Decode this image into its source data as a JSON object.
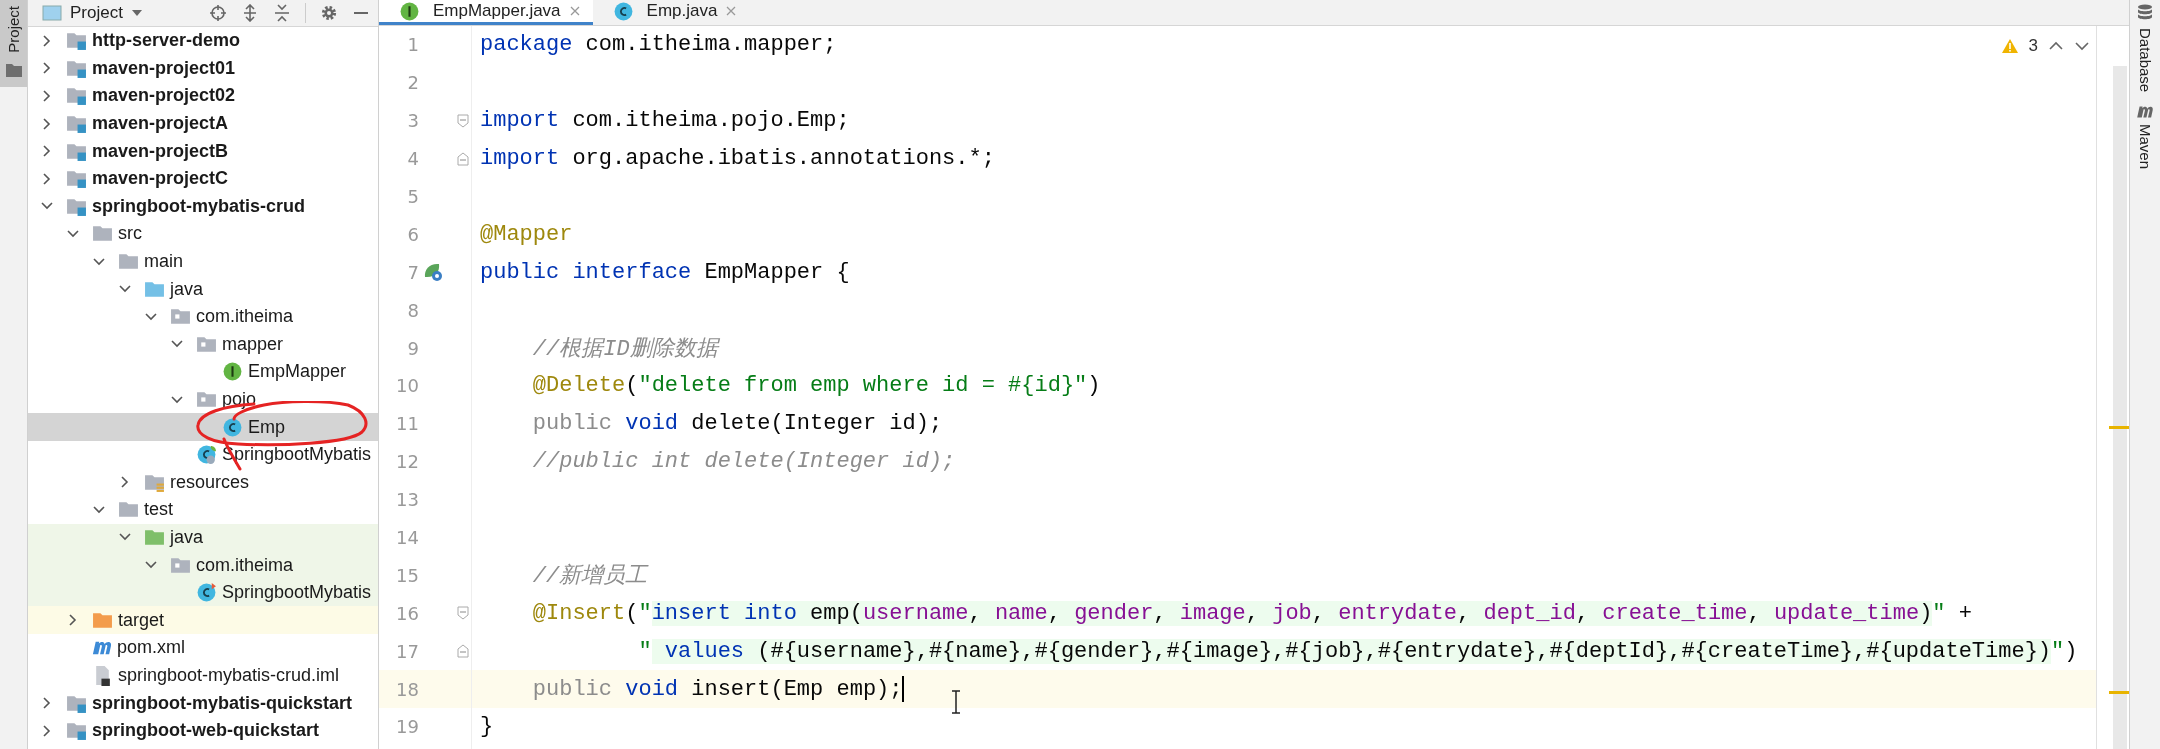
{
  "left_tool_strip": [
    {
      "label": "Project",
      "selected": true
    }
  ],
  "project_panel": {
    "title": "Project",
    "tree": [
      {
        "label": "http-server-demo",
        "kind": "module",
        "expanded": false,
        "selected": false
      },
      {
        "label": "maven-project01",
        "kind": "module",
        "expanded": false,
        "selected": false
      },
      {
        "label": "maven-project02",
        "kind": "module",
        "expanded": false,
        "selected": false
      },
      {
        "label": "maven-projectA",
        "kind": "module",
        "expanded": false,
        "selected": false
      },
      {
        "label": "maven-projectB",
        "kind": "module",
        "expanded": false,
        "selected": false
      },
      {
        "label": "maven-projectC",
        "kind": "module",
        "expanded": false,
        "selected": false
      },
      {
        "label": "springboot-mybatis-crud",
        "kind": "module",
        "expanded": true,
        "selected": false,
        "children": [
          {
            "label": "src",
            "kind": "folder",
            "expanded": true,
            "selected": false,
            "children": [
              {
                "label": "main",
                "kind": "folder",
                "expanded": true,
                "selected": false,
                "children": [
                  {
                    "label": "java",
                    "kind": "source",
                    "expanded": true,
                    "selected": false,
                    "children": [
                      {
                        "label": "com.itheima",
                        "kind": "package",
                        "expanded": true,
                        "selected": false,
                        "children": [
                          {
                            "label": "mapper",
                            "kind": "package",
                            "expanded": true,
                            "selected": false,
                            "children": [
                              {
                                "label": "EmpMapper",
                                "kind": "interface",
                                "selected": false
                              }
                            ]
                          },
                          {
                            "label": "pojo",
                            "kind": "package",
                            "expanded": true,
                            "selected": false,
                            "children": [
                              {
                                "label": "Emp",
                                "kind": "class",
                                "selected": true
                              }
                            ]
                          },
                          {
                            "label": "SpringbootMybatis",
                            "kind": "spring-class",
                            "selected": false
                          }
                        ]
                      }
                    ]
                  },
                  {
                    "label": "resources",
                    "kind": "resources",
                    "expanded": false,
                    "selected": false
                  }
                ]
              },
              {
                "label": "test",
                "kind": "folder",
                "expanded": true,
                "selected": false,
                "children": [
                  {
                    "label": "java",
                    "kind": "test-source",
                    "expanded": true,
                    "selected": false,
                    "children": [
                      {
                        "label": "com.itheima",
                        "kind": "package",
                        "expanded": true,
                        "selected": false,
                        "children": [
                          {
                            "label": "SpringbootMybatis",
                            "kind": "test-class",
                            "selected": false
                          }
                        ]
                      }
                    ]
                  }
                ]
              }
            ]
          },
          {
            "label": "target",
            "kind": "excluded",
            "expanded": false,
            "selected": false
          },
          {
            "label": "pom.xml",
            "kind": "maven",
            "selected": false
          },
          {
            "label": "springboot-mybatis-crud.iml",
            "kind": "iml",
            "selected": false
          }
        ]
      },
      {
        "label": "springboot-mybatis-quickstart",
        "kind": "module",
        "expanded": false,
        "selected": false
      },
      {
        "label": "springboot-web-quickstart",
        "kind": "module",
        "expanded": false,
        "selected": false
      }
    ]
  },
  "editor": {
    "tabs": [
      {
        "label": "EmpMapper.java",
        "kind": "interface",
        "selected": true
      },
      {
        "label": "Emp.java",
        "kind": "class",
        "selected": false
      }
    ],
    "warning_count": "3",
    "lines": [
      {
        "number": "1",
        "warning": false,
        "current": false,
        "caret": false,
        "fold_start": false,
        "fold_end": false,
        "gutter_icon": false,
        "tokens": [
          {
            "kind": "keyword",
            "text": "package"
          },
          {
            "kind": "plain",
            "text": " com.itheima.mapper;"
          }
        ]
      },
      {
        "number": "2",
        "warning": false,
        "current": false,
        "caret": false,
        "fold_start": false,
        "fold_end": false,
        "gutter_icon": false
      },
      {
        "number": "3",
        "warning": false,
        "current": false,
        "caret": false,
        "fold_start": true,
        "fold_end": false,
        "gutter_icon": false,
        "tokens": [
          {
            "kind": "keyword",
            "text": "import"
          },
          {
            "kind": "plain",
            "text": " com.itheima.pojo.Emp;"
          }
        ]
      },
      {
        "number": "4",
        "warning": false,
        "current": false,
        "caret": false,
        "fold_start": false,
        "fold_end": true,
        "gutter_icon": false,
        "tokens": [
          {
            "kind": "keyword",
            "text": "import"
          },
          {
            "kind": "plain",
            "text": " org.apache.ibatis.annotations.*;"
          }
        ]
      },
      {
        "number": "5",
        "warning": false,
        "current": false,
        "caret": false,
        "fold_start": false,
        "fold_end": false,
        "gutter_icon": false
      },
      {
        "number": "6",
        "warning": false,
        "current": false,
        "caret": false,
        "fold_start": false,
        "fold_end": false,
        "gutter_icon": false,
        "tokens": [
          {
            "kind": "annotation",
            "text": "@Mapper"
          }
        ]
      },
      {
        "number": "7",
        "warning": false,
        "current": false,
        "caret": false,
        "fold_start": false,
        "fold_end": false,
        "gutter_icon": true,
        "tokens": [
          {
            "kind": "keyword",
            "text": "public interface"
          },
          {
            "kind": "plain",
            "text": " EmpMapper {"
          }
        ]
      },
      {
        "number": "8",
        "warning": false,
        "current": false,
        "caret": false,
        "fold_start": false,
        "fold_end": false,
        "gutter_icon": false
      },
      {
        "number": "9",
        "warning": false,
        "current": false,
        "caret": false,
        "fold_start": false,
        "fold_end": false,
        "gutter_icon": false,
        "tokens": [
          {
            "kind": "comment",
            "text": "    //根据ID删除数据"
          }
        ]
      },
      {
        "number": "10",
        "warning": false,
        "current": false,
        "caret": false,
        "fold_start": false,
        "fold_end": false,
        "gutter_icon": false,
        "tokens": [
          {
            "kind": "annotation",
            "text": "    @Delete"
          },
          {
            "kind": "plain",
            "text": "("
          },
          {
            "kind": "string",
            "text": "\"delete from emp where id = #{id}\""
          },
          {
            "kind": "plain",
            "text": ")"
          }
        ]
      },
      {
        "number": "11",
        "warning": true,
        "current": false,
        "caret": false,
        "fold_start": false,
        "fold_end": false,
        "gutter_icon": false,
        "tokens": [
          {
            "kind": "modifier",
            "text": "    public"
          },
          {
            "kind": "keyword",
            "text": " void"
          },
          {
            "kind": "plain",
            "text": " delete(Integer id);"
          }
        ]
      },
      {
        "number": "12",
        "warning": false,
        "current": false,
        "caret": false,
        "fold_start": false,
        "fold_end": false,
        "gutter_icon": false,
        "tokens": [
          {
            "kind": "comment",
            "text": "    //public int delete(Integer id);"
          }
        ]
      },
      {
        "number": "13",
        "warning": false,
        "current": false,
        "caret": false,
        "fold_start": false,
        "fold_end": false,
        "gutter_icon": false
      },
      {
        "number": "14",
        "warning": false,
        "current": false,
        "caret": false,
        "fold_start": false,
        "fold_end": false,
        "gutter_icon": false
      },
      {
        "number": "15",
        "warning": false,
        "current": false,
        "caret": false,
        "fold_start": false,
        "fold_end": false,
        "gutter_icon": false,
        "tokens": [
          {
            "kind": "comment",
            "text": "    //新增员工"
          }
        ]
      },
      {
        "number": "16",
        "warning": false,
        "current": false,
        "caret": false,
        "fold_start": true,
        "fold_end": false,
        "gutter_icon": false,
        "tokens": [
          {
            "kind": "annotation",
            "text": "    @Insert"
          },
          {
            "kind": "plain",
            "text": "("
          },
          {
            "kind": "string",
            "text": "\""
          },
          {
            "kind": "sql-keyword",
            "text": "insert into"
          },
          {
            "kind": "sql-plain",
            "text": " emp("
          },
          {
            "kind": "sql-column",
            "text": "username"
          },
          {
            "kind": "sql-plain",
            "text": ", "
          },
          {
            "kind": "sql-column",
            "text": "name"
          },
          {
            "kind": "sql-plain",
            "text": ", "
          },
          {
            "kind": "sql-column",
            "text": "gender"
          },
          {
            "kind": "sql-plain",
            "text": ", "
          },
          {
            "kind": "sql-column",
            "text": "image"
          },
          {
            "kind": "sql-plain",
            "text": ", "
          },
          {
            "kind": "sql-column",
            "text": "job"
          },
          {
            "kind": "sql-plain",
            "text": ", "
          },
          {
            "kind": "sql-column",
            "text": "entrydate"
          },
          {
            "kind": "sql-plain",
            "text": ", "
          },
          {
            "kind": "sql-column",
            "text": "dept_id"
          },
          {
            "kind": "sql-plain",
            "text": ", "
          },
          {
            "kind": "sql-column",
            "text": "create_time"
          },
          {
            "kind": "sql-plain",
            "text": ", "
          },
          {
            "kind": "sql-column",
            "text": "update_time"
          },
          {
            "kind": "sql-plain",
            "text": ")"
          },
          {
            "kind": "string",
            "text": "\""
          },
          {
            "kind": "plain",
            "text": " +"
          }
        ]
      },
      {
        "number": "17",
        "warning": false,
        "current": false,
        "caret": false,
        "fold_start": false,
        "fold_end": true,
        "gutter_icon": false,
        "tokens": [
          {
            "kind": "string",
            "text": "            \""
          },
          {
            "kind": "sql-keyword",
            "text": " values"
          },
          {
            "kind": "sql-plain",
            "text": " (#{username},#{name},#{gender},#{image},#{job},#{entrydate},#{deptId},#{createTime},#{updateTime})"
          },
          {
            "kind": "string",
            "text": "\""
          },
          {
            "kind": "plain",
            "text": ")"
          }
        ]
      },
      {
        "number": "18",
        "warning": true,
        "current": true,
        "caret": true,
        "fold_start": false,
        "fold_end": false,
        "gutter_icon": false,
        "tokens": [
          {
            "kind": "modifier",
            "text": "    public"
          },
          {
            "kind": "keyword",
            "text": " void"
          },
          {
            "kind": "plain",
            "text": " insert(Emp emp);"
          }
        ]
      },
      {
        "number": "19",
        "warning": false,
        "current": false,
        "caret": false,
        "fold_start": false,
        "fold_end": false,
        "gutter_icon": false,
        "tokens": [
          {
            "kind": "plain",
            "text": "}"
          }
        ]
      }
    ]
  },
  "right_tool_strip": [
    {
      "label": "Database",
      "kind": "database"
    },
    {
      "label": "Maven",
      "kind": "maven"
    }
  ]
}
